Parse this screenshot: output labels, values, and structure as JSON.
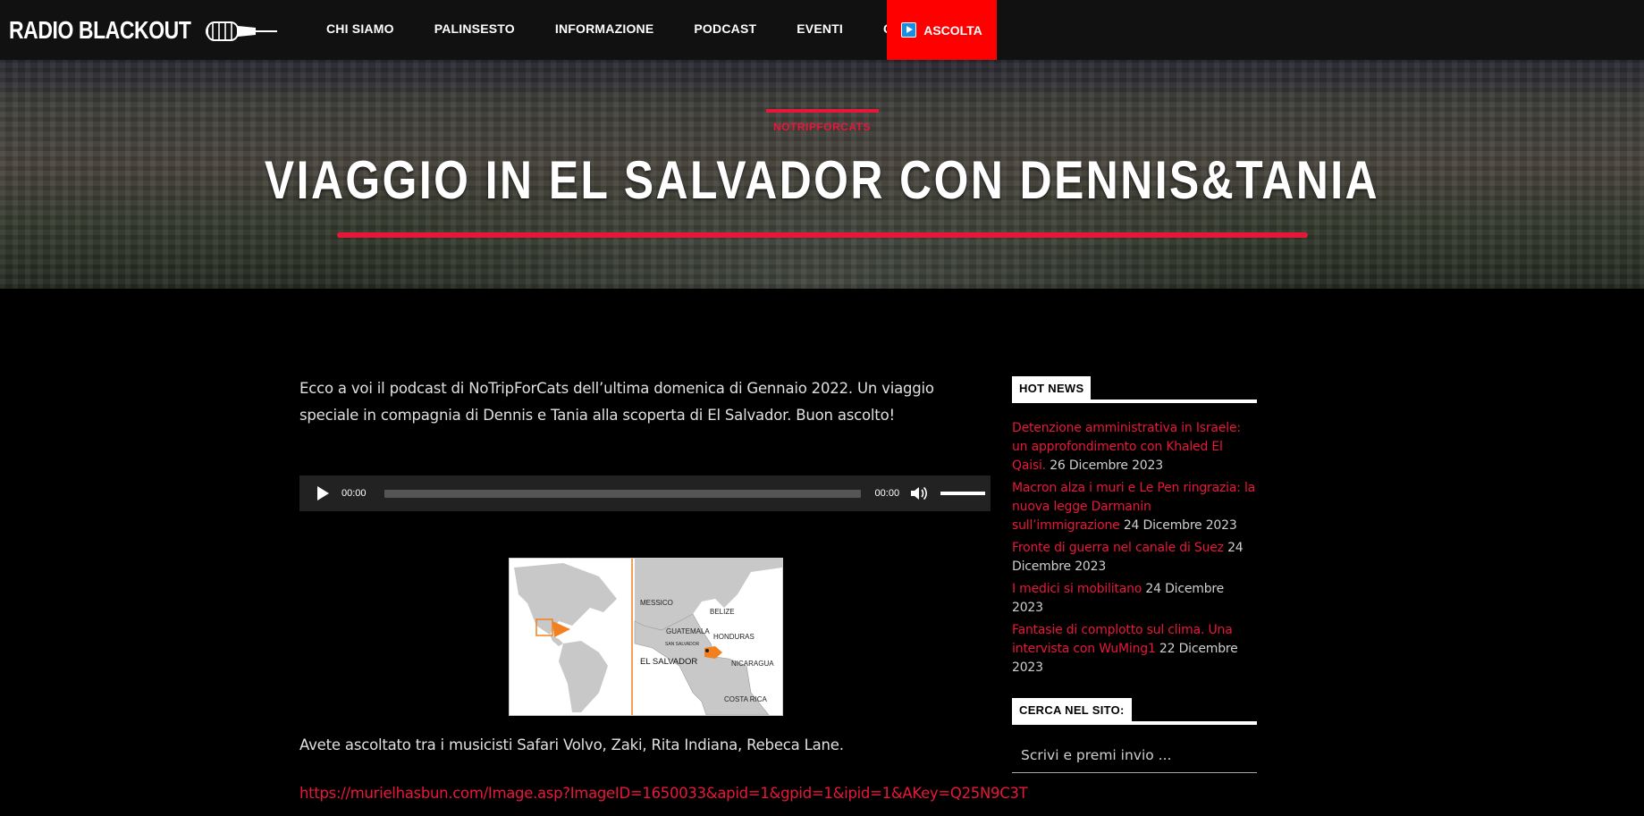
{
  "brand": {
    "name": "RADIO BLACKOUT"
  },
  "nav": {
    "items": [
      {
        "label": "CHI SIAMO"
      },
      {
        "label": "PALINSESTO"
      },
      {
        "label": "INFORMAZIONE"
      },
      {
        "label": "PODCAST"
      },
      {
        "label": "EVENTI"
      },
      {
        "label": "CONTATTI"
      }
    ],
    "listen_label": "ASCOLTA"
  },
  "hero": {
    "category": "NOTRIPFORCATS",
    "title": "VIAGGIO IN EL SALVADOR CON DENNIS&TANIA"
  },
  "article": {
    "intro": "Ecco a voi il podcast di NoTripForCats dell’ultima domenica di Gennaio 2022. Un viaggio speciale in compagnia di Dennis e Tania alla scoperta di El Salvador. Buon ascolto!",
    "player": {
      "current_time": "00:00",
      "duration": "00:00",
      "progress": 0,
      "volume": 1
    },
    "map": {
      "labels": {
        "mexico": "MESSICO",
        "belize": "BELIZE",
        "guatemala": "GUATEMALA",
        "honduras": "HONDURAS",
        "san_salvador": "SAN SALVADOR",
        "el_salvador": "EL SALVADOR",
        "nicaragua": "NICARAGUA",
        "costa_rica": "COSTA RICA"
      }
    },
    "artists": "Avete ascoltato tra i musicisti Safari Volvo, Zaki, Rita Indiana, Rebeca Lane.",
    "source_link": "https://murielhasbun.com/Image.asp?ImageID=1650033&apid=1&gpid=1&ipid=1&AKey=Q25N9C3T"
  },
  "sidebar": {
    "hot_news": {
      "title": "HOT NEWS",
      "items": [
        {
          "link": "Detenzione amministrativa in Israele: un approfondimento con Khaled El Qaisi.",
          "date": "26 Dicembre 2023"
        },
        {
          "link": "Macron alza i muri e Le Pen ringrazia: la nuova legge Darmanin sull’immigrazione",
          "date": "24 Dicembre 2023"
        },
        {
          "link": "Fronte di guerra nel canale di Suez",
          "date": "24 Dicembre 2023"
        },
        {
          "link": "I medici si mobilitano",
          "date": "24 Dicembre 2023"
        },
        {
          "link": "Fantasie di complotto sul clima. Una intervista con WuMing1",
          "date": "22 Dicembre 2023"
        }
      ]
    },
    "search": {
      "title": "CERCA NEL SITO:",
      "placeholder": "Scrivi e premi invio ..."
    }
  }
}
